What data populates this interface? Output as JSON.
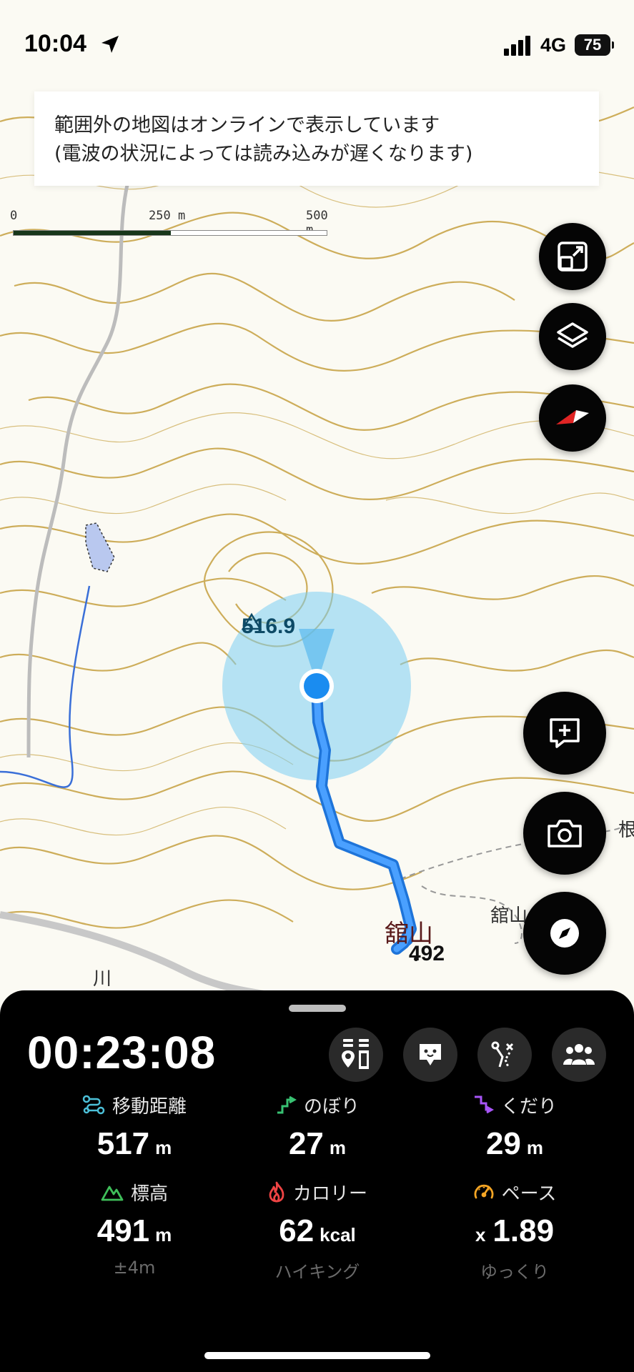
{
  "status_bar": {
    "time": "10:04",
    "network": "4G",
    "battery": "75"
  },
  "banner": {
    "line1": "範囲外の地図はオンラインで表示しています",
    "line2": "(電波の状況によっては読み込みが遅くなります)"
  },
  "scale": {
    "label_0": "0",
    "label_mid": "250 m",
    "label_end": "500 m"
  },
  "map": {
    "elevation_label": "516.9",
    "peak_name": "舘山",
    "peak_name_right": "舘山",
    "peak_elevation": "492",
    "river_label": "川",
    "edge_label": "根"
  },
  "controls": {
    "icons": [
      "fullscreen-icon",
      "layers-icon",
      "compass-icon",
      "add-memo-icon",
      "camera-icon",
      "navigation-compass-icon"
    ]
  },
  "panel": {
    "elapsed_time": "00:23:08",
    "stats": [
      {
        "label": "移動距離",
        "value": "517",
        "unit": "m",
        "icon": "distance-icon",
        "color": "#4cc0d8"
      },
      {
        "label": "のぼり",
        "value": "27",
        "unit": "m",
        "icon": "ascent-icon",
        "color": "#38c172"
      },
      {
        "label": "くだり",
        "value": "29",
        "unit": "m",
        "icon": "descent-icon",
        "color": "#a855f7"
      },
      {
        "label": "標高",
        "value": "491",
        "unit": "m",
        "sub": "±4m",
        "icon": "elevation-icon",
        "color": "#3fbf5a"
      },
      {
        "label": "カロリー",
        "value": "62",
        "unit": "kcal",
        "sub": "ハイキング",
        "icon": "calorie-icon",
        "color": "#ef4444"
      },
      {
        "label": "ペース",
        "prefix": "x",
        "value": "1.89",
        "sub": "ゆっくり",
        "icon": "pace-icon",
        "color": "#f5a524"
      }
    ]
  }
}
